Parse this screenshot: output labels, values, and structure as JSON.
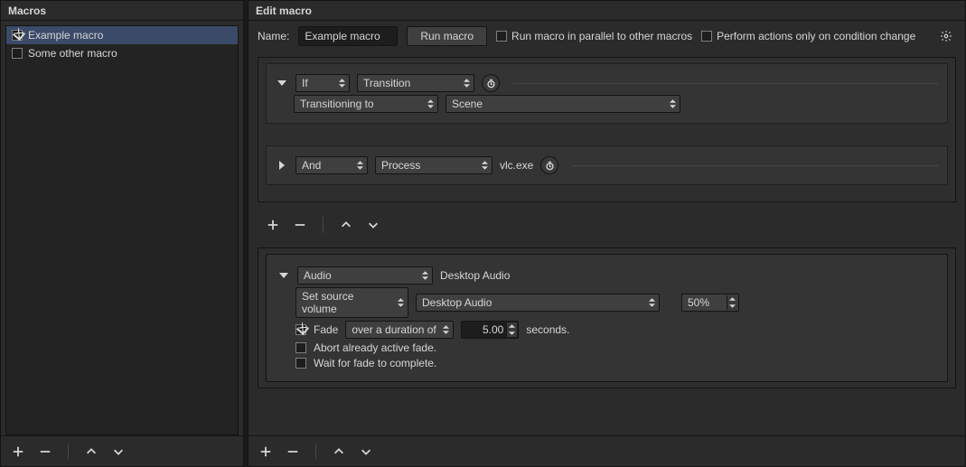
{
  "left": {
    "title": "Macros",
    "items": [
      {
        "label": "Example macro",
        "checked": true,
        "selected": true
      },
      {
        "label": "Some other macro",
        "checked": false,
        "selected": false
      }
    ]
  },
  "right": {
    "title": "Edit macro",
    "name_label": "Name:",
    "name_value": "Example macro",
    "run_label": "Run macro",
    "parallel_label": "Run macro in parallel to other macros",
    "on_change_label": "Perform actions only on condition change"
  },
  "cond1": {
    "logic": "If",
    "type": "Transition",
    "sub": "Transitioning to",
    "target": "Scene"
  },
  "cond2": {
    "logic": "And",
    "type": "Process",
    "value": "vlc.exe"
  },
  "action": {
    "type": "Audio",
    "source": "Desktop Audio",
    "op": "Set source volume",
    "target": "Desktop Audio",
    "volume": "50%",
    "fade_label": "Fade",
    "fade_mode": "over a duration of",
    "fade_dur": "5.00",
    "seconds": "seconds.",
    "abort": "Abort already active fade.",
    "wait": "Wait for fade to complete."
  }
}
